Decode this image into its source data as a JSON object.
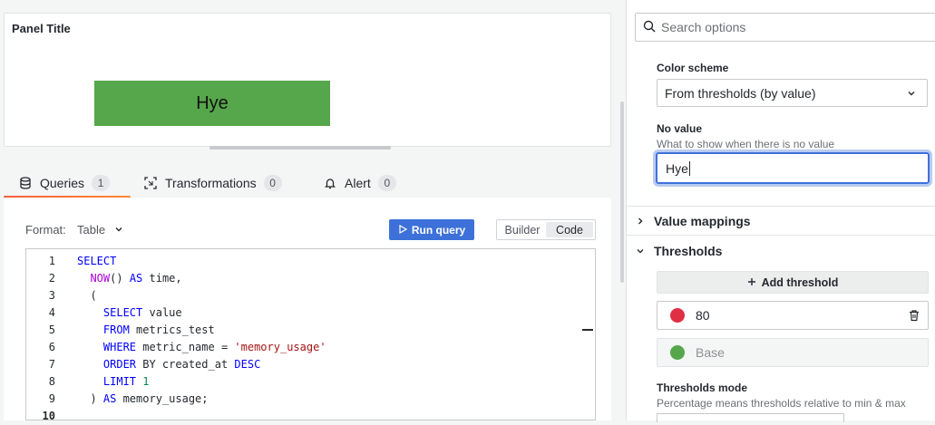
{
  "panel": {
    "title": "Panel Title",
    "stat_value": "Hye",
    "stat_color": "#56a64b"
  },
  "tabs": [
    {
      "label": "Queries",
      "count": "1",
      "icon": "database-icon"
    },
    {
      "label": "Transformations",
      "count": "0",
      "icon": "transform-icon"
    },
    {
      "label": "Alert",
      "count": "0",
      "icon": "bell-icon"
    }
  ],
  "query": {
    "format_label": "Format:",
    "format_value": "Table",
    "run_label": "Run query",
    "mode_builder": "Builder",
    "mode_code": "Code",
    "lines": [
      {
        "n": "1",
        "code": "SELECT"
      },
      {
        "n": "2",
        "code": "  NOW() AS time,"
      },
      {
        "n": "3",
        "code": "  ("
      },
      {
        "n": "4",
        "code": "    SELECT value"
      },
      {
        "n": "5",
        "code": "    FROM metrics_test"
      },
      {
        "n": "6",
        "code": "    WHERE metric_name = 'memory_usage'"
      },
      {
        "n": "7",
        "code": "    ORDER BY created_at DESC"
      },
      {
        "n": "8",
        "code": "    LIMIT 1"
      },
      {
        "n": "9",
        "code": "  ) AS memory_usage;"
      },
      {
        "n": "10",
        "code": ""
      }
    ]
  },
  "options": {
    "search_placeholder": "Search options",
    "color_scheme_label": "Color scheme",
    "color_scheme_value": "From thresholds (by value)",
    "no_value_label": "No value",
    "no_value_desc": "What to show when there is no value",
    "no_value_input": "Hye",
    "value_mappings_label": "Value mappings",
    "thresholds_label": "Thresholds",
    "add_threshold_label": "Add threshold",
    "thresholds": [
      {
        "value": "80",
        "color": "#e02f44"
      },
      {
        "value": "Base",
        "color": "#56a64b"
      }
    ],
    "thresholds_mode_label": "Thresholds mode",
    "thresholds_mode_desc": "Percentage means thresholds relative to min & max"
  }
}
